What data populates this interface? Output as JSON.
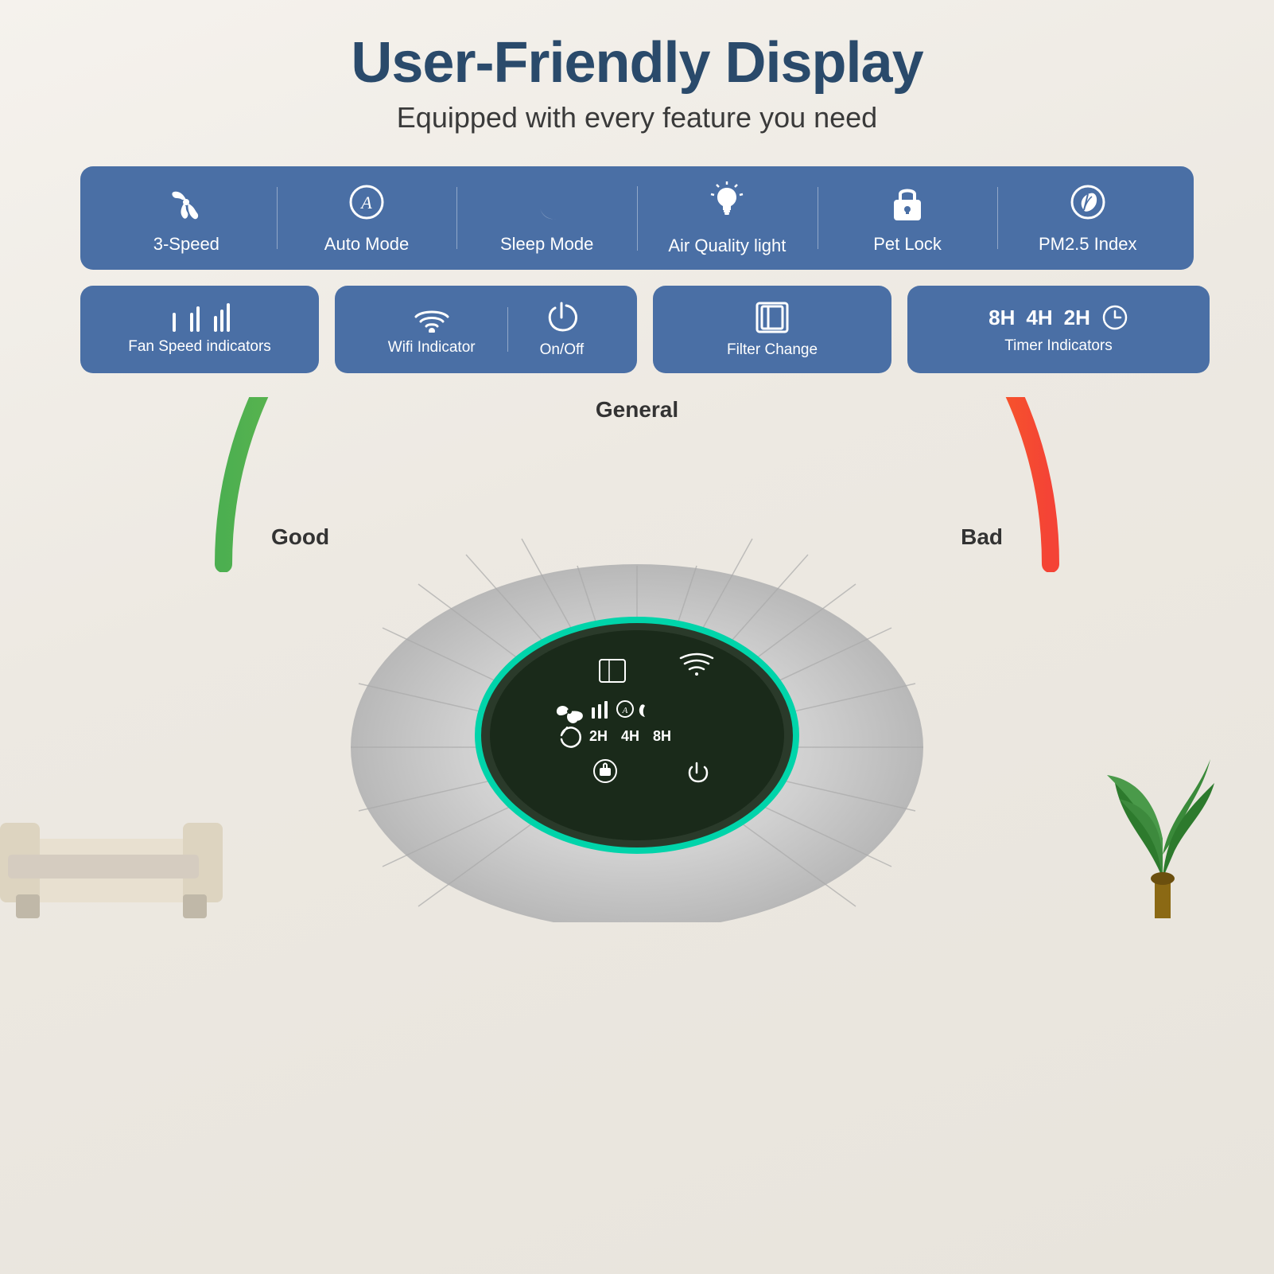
{
  "header": {
    "main_title": "User-Friendly Display",
    "sub_title": "Equipped with every feature you need"
  },
  "feature_bar_1": {
    "items": [
      {
        "id": "speed",
        "icon": "✦",
        "label": "3-Speed"
      },
      {
        "id": "auto",
        "icon": "Ⓐ",
        "label": "Auto Mode"
      },
      {
        "id": "sleep",
        "icon": "☾",
        "label": "Sleep Mode"
      },
      {
        "id": "airquality",
        "icon": "💡",
        "label": "Air Quality light"
      },
      {
        "id": "petlock",
        "icon": "🔒",
        "label": "Pet Lock"
      },
      {
        "id": "pm25",
        "icon": "🌿",
        "label": "PM2.5 Index"
      }
    ]
  },
  "feature_bar_2": {
    "groups": [
      {
        "id": "fan-speed",
        "icons": [
          "▎",
          "▎▎",
          "▎▎▎"
        ],
        "label": "Fan Speed indicators"
      },
      {
        "id": "wifi-onoff",
        "icons": [
          "📶",
          "⏻"
        ],
        "labels": [
          "Wifi Indicator",
          "On/Off"
        ]
      },
      {
        "id": "filter",
        "icon": "⊡",
        "label": "Filter Change"
      },
      {
        "id": "timer",
        "icons": [
          "8H",
          "4H",
          "2H",
          "◷"
        ],
        "label": "Timer Indicators"
      }
    ]
  },
  "gauge": {
    "good_label": "Good",
    "general_label": "General",
    "bad_label": "Bad"
  },
  "control_panel": {
    "rows": [
      [
        "⊡",
        "〜"
      ],
      [
        "✦",
        "▎",
        "▎▎",
        "▎▎▎",
        "⊛",
        "☾"
      ],
      [
        "◷",
        "2H",
        "4H",
        "8H"
      ],
      [
        "⊙",
        "⏻"
      ]
    ]
  },
  "colors": {
    "feature_bar_bg": "#4a6fa5",
    "title_color": "#2a4a6b",
    "accent_teal": "#00d4aa"
  }
}
